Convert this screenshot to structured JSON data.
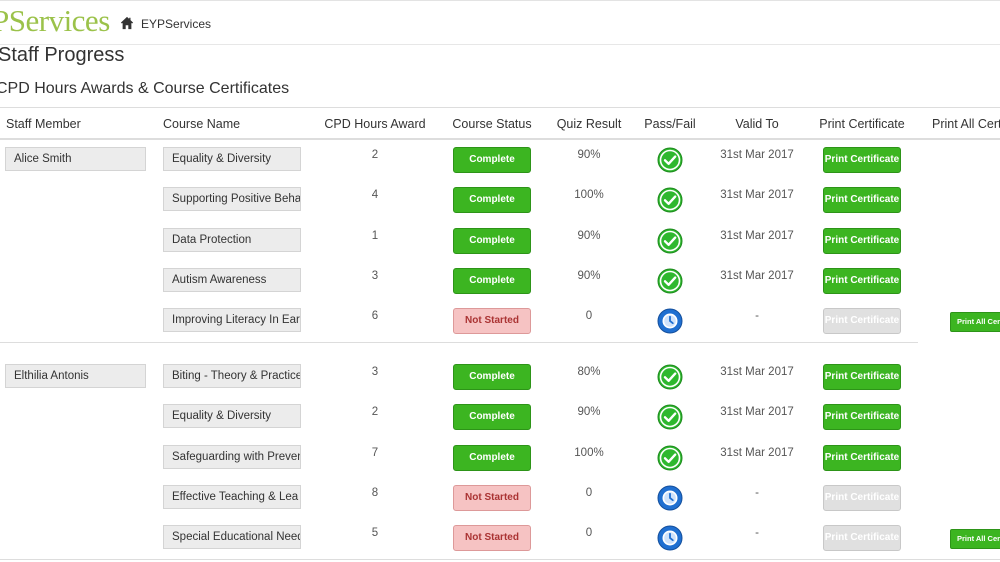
{
  "header": {
    "logo_text": "PServices",
    "home_label": "EYPServices"
  },
  "page_title": "Staff Progress",
  "section_title": "CPD Hours Awards & Course Certificates",
  "columns": {
    "staff_member": "Staff Member",
    "course_name": "Course Name",
    "cpd_hours_award": "CPD Hours Award",
    "course_status": "Course Status",
    "quiz_result": "Quiz Result",
    "pass_fail": "Pass/Fail",
    "valid_to": "Valid To",
    "print_certificate": "Print Certificate",
    "print_all": "Print All Cert"
  },
  "staff": [
    {
      "name": "Alice Smith",
      "print_all_label": "Print All Certificates",
      "courses": [
        {
          "course": "Equality & Diversity",
          "hours": "2",
          "status": "Complete",
          "quiz": "90%",
          "result": "pass",
          "valid_to": "31st Mar 2017",
          "print_label": "Print Certificate",
          "print_enabled": true
        },
        {
          "course": "Supporting Positive Beha",
          "hours": "4",
          "status": "Complete",
          "quiz": "100%",
          "result": "pass",
          "valid_to": "31st Mar 2017",
          "print_label": "Print Certificate",
          "print_enabled": true
        },
        {
          "course": "Data Protection",
          "hours": "1",
          "status": "Complete",
          "quiz": "90%",
          "result": "pass",
          "valid_to": "31st Mar 2017",
          "print_label": "Print Certificate",
          "print_enabled": true
        },
        {
          "course": "Autism Awareness",
          "hours": "3",
          "status": "Complete",
          "quiz": "90%",
          "result": "pass",
          "valid_to": "31st Mar 2017",
          "print_label": "Print Certificate",
          "print_enabled": true
        },
        {
          "course": "Improving Literacy In Ear",
          "hours": "6",
          "status": "Not Started",
          "quiz": "0",
          "result": "pending",
          "valid_to": "-",
          "print_label": "Print Certificate",
          "print_enabled": false
        }
      ]
    },
    {
      "name": "Elthilia Antonis",
      "print_all_label": "Print All Certificates",
      "courses": [
        {
          "course": "Biting - Theory & Practice",
          "hours": "3",
          "status": "Complete",
          "quiz": "80%",
          "result": "pass",
          "valid_to": "31st Mar 2017",
          "print_label": "Print Certificate",
          "print_enabled": true
        },
        {
          "course": "Equality & Diversity",
          "hours": "2",
          "status": "Complete",
          "quiz": "90%",
          "result": "pass",
          "valid_to": "31st Mar 2017",
          "print_label": "Print Certificate",
          "print_enabled": true
        },
        {
          "course": "Safeguarding with Preven",
          "hours": "7",
          "status": "Complete",
          "quiz": "100%",
          "result": "pass",
          "valid_to": "31st Mar 2017",
          "print_label": "Print Certificate",
          "print_enabled": true
        },
        {
          "course": "Effective Teaching & Lea",
          "hours": "8",
          "status": "Not Started",
          "quiz": "0",
          "result": "pending",
          "valid_to": "-",
          "print_label": "Print Certificate",
          "print_enabled": false
        },
        {
          "course": "Special Educational Need",
          "hours": "5",
          "status": "Not Started",
          "quiz": "0",
          "result": "pending",
          "valid_to": "-",
          "print_label": "Print Certificate",
          "print_enabled": false
        }
      ]
    }
  ],
  "colors": {
    "brand_logo": "#9bc24a",
    "complete_green": "#3cb521",
    "pass_green": "#2eb82e",
    "pending_blue": "#1f6fd1",
    "not_started_pink": "#f6c3c3"
  }
}
